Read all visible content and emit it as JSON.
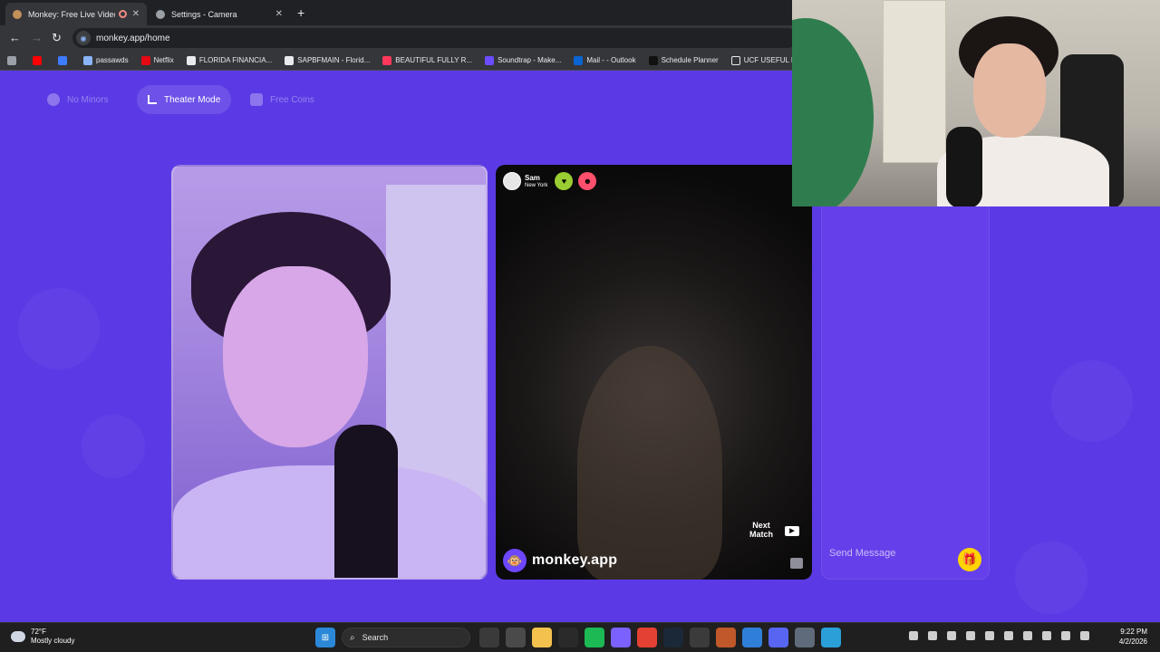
{
  "browser": {
    "tabs": [
      {
        "title": "Monkey: Free Live Video Ch",
        "active": true
      },
      {
        "title": "Settings - Camera",
        "active": false
      }
    ],
    "new_tab": "+",
    "url": "monkey.app/home",
    "bookmarks": [
      {
        "label": "",
        "icon": "youtube-icon",
        "color": "#ff0000"
      },
      {
        "label": "",
        "icon": "roblox-icon",
        "color": "#3d7bff"
      },
      {
        "label": "passawds",
        "icon": "doc-icon",
        "color": "#8ab4f8"
      },
      {
        "label": "Netflix",
        "icon": "netflix-icon",
        "color": "#e50914"
      },
      {
        "label": "FLORIDA FINANCIA...",
        "icon": "doc-icon",
        "color": "#e8eaed"
      },
      {
        "label": "SAPBFMAIN - Florid...",
        "icon": "doc-icon",
        "color": "#e8eaed"
      },
      {
        "label": "BEAUTIFUL FULLY R...",
        "icon": "airbnb-icon",
        "color": "#ff385c"
      },
      {
        "label": "Soundtrap - Make...",
        "icon": "soundtrap-icon",
        "color": "#6b4cff"
      },
      {
        "label": "Mail - - Outlook",
        "icon": "outlook-icon",
        "color": "#0a64d1"
      },
      {
        "label": "Schedule Planner",
        "icon": "planner-icon",
        "color": "#1e1e1e"
      },
      {
        "label": "UCF USEFUL LINKS",
        "icon": "folder-icon",
        "color": "#e8eaed"
      }
    ]
  },
  "page": {
    "top_buttons": {
      "no_minors": "No Minors",
      "theater_mode": "Theater Mode",
      "free_coins": "Free Coins"
    },
    "partner": {
      "name": "Sam",
      "location": "New York"
    },
    "next_match": "Next Match",
    "brand": "monkey.app",
    "chat": {
      "placeholder": "Send Message"
    }
  },
  "taskbar": {
    "weather_temp": "72°F",
    "weather_desc": "Mostly cloudy",
    "search_label": "Search",
    "time": "9:22 PM",
    "date": "4/2/2026"
  },
  "colors": {
    "page_bg": "#5b3ae5",
    "accent_yellow": "#ffd400"
  }
}
